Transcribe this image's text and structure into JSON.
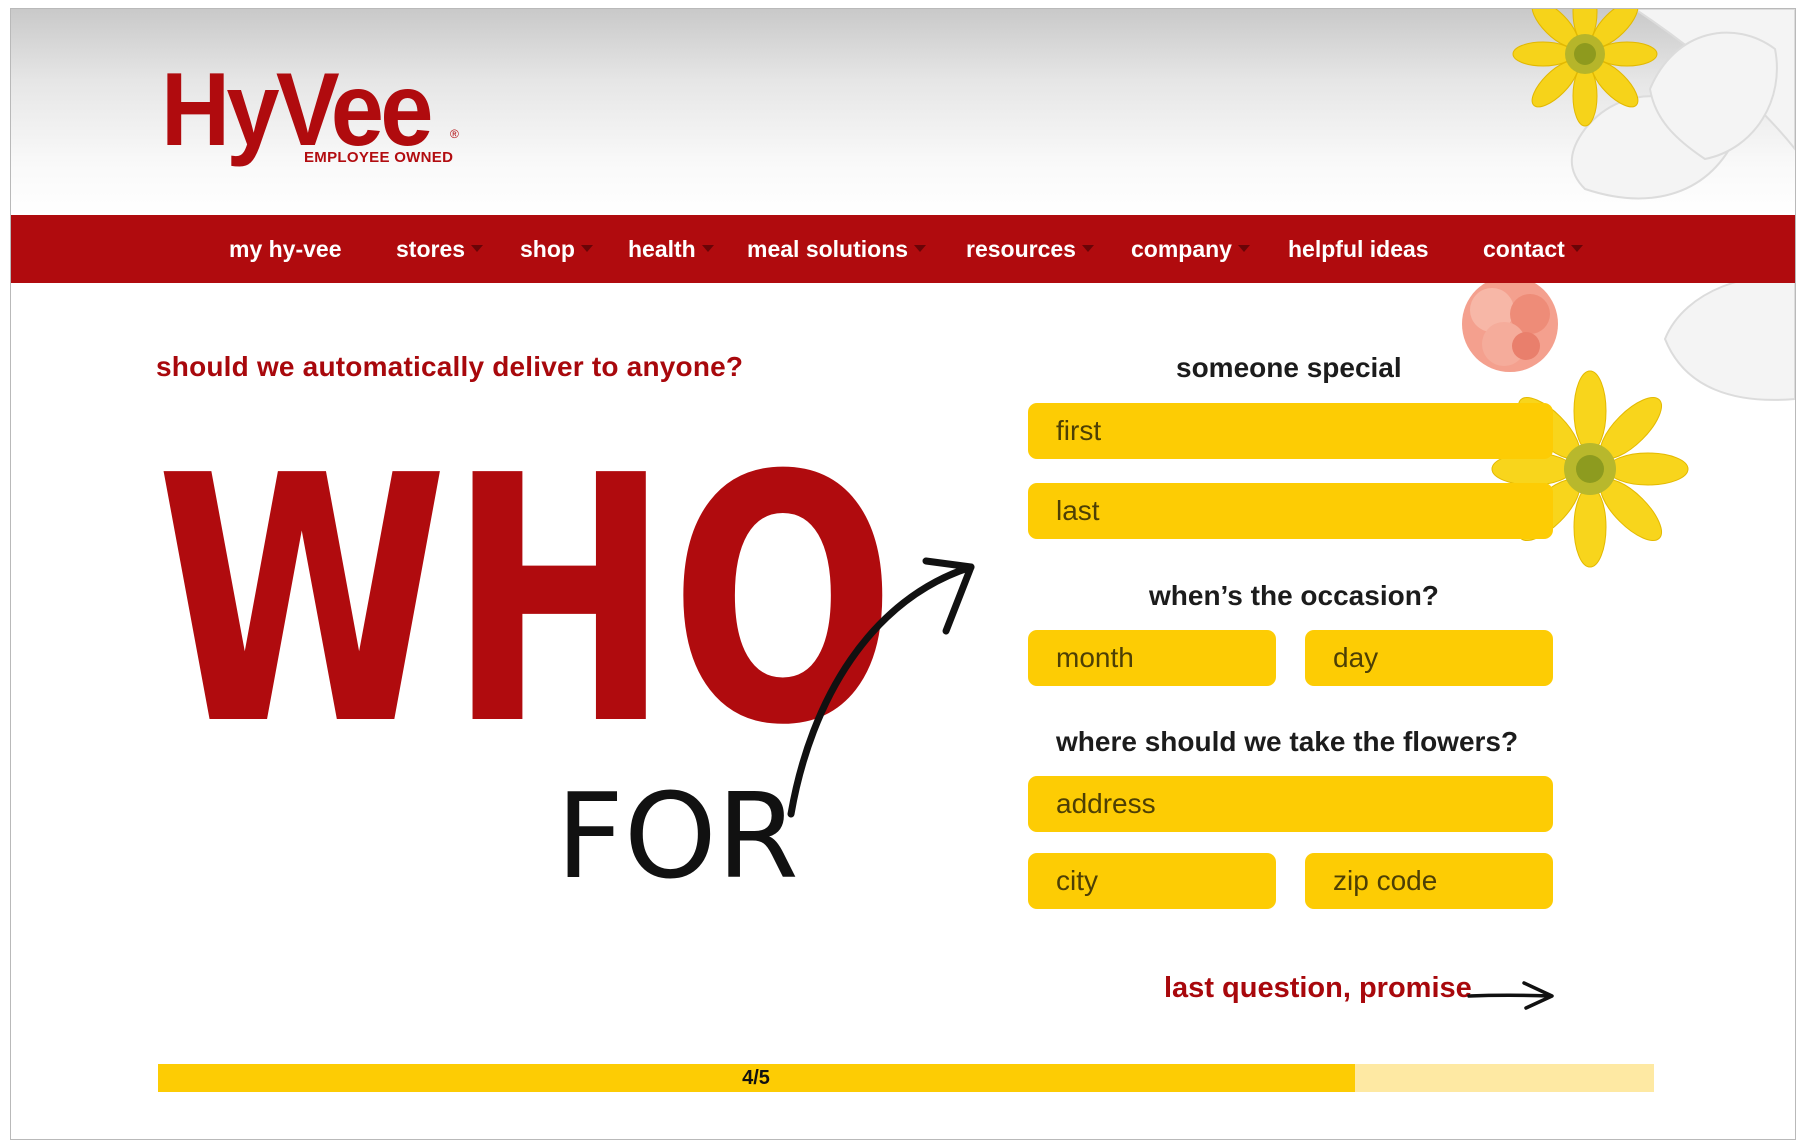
{
  "brand": {
    "logo_text": "HyVee",
    "tagline": "EMPLOYEE OWNED",
    "registered": "®",
    "color": "#b00b0e"
  },
  "nav": {
    "items": [
      {
        "label": "my hy-vee",
        "has_dropdown": false
      },
      {
        "label": "stores",
        "has_dropdown": true
      },
      {
        "label": "shop",
        "has_dropdown": true
      },
      {
        "label": "health",
        "has_dropdown": true
      },
      {
        "label": "meal solutions",
        "has_dropdown": true
      },
      {
        "label": "resources",
        "has_dropdown": true
      },
      {
        "label": "company",
        "has_dropdown": true
      },
      {
        "label": "helpful ideas",
        "has_dropdown": false
      },
      {
        "label": "contact",
        "has_dropdown": true
      }
    ]
  },
  "main": {
    "question": "should we automatically deliver to anyone?",
    "headline_big": "WHO",
    "headline_small": "FOR"
  },
  "form": {
    "recipient_label": "someone special",
    "first_placeholder": "first",
    "last_placeholder": "last",
    "occasion_label": "when’s the occasion?",
    "month_placeholder": "month",
    "day_placeholder": "day",
    "address_label": "where should we take the flowers?",
    "address_placeholder": "address",
    "city_placeholder": "city",
    "zip_placeholder": "zip code",
    "next_label": "last question, promise"
  },
  "progress": {
    "text": "4/5",
    "fraction": 0.8
  },
  "colors": {
    "accent_red": "#a8080c",
    "field_yellow": "#fdcc04",
    "progress_track": "#fee9a3"
  }
}
